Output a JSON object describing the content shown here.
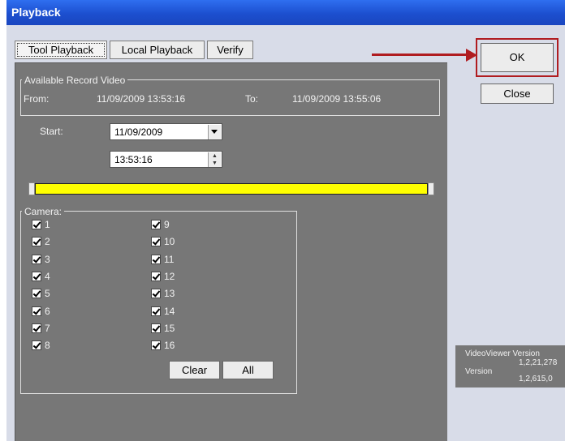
{
  "window": {
    "title": "Playback"
  },
  "tabs": [
    {
      "label": "Tool Playback",
      "active": true
    },
    {
      "label": "Local Playback",
      "active": false
    },
    {
      "label": "Verify",
      "active": false
    }
  ],
  "record": {
    "legend": "Available Record Video",
    "from_label": "From:",
    "from_value": "11/09/2009 13:53:16",
    "to_label": "To:",
    "to_value": "11/09/2009 13:55:06"
  },
  "start": {
    "label": "Start:",
    "date": "11/09/2009",
    "time": "13:53:16"
  },
  "slider": {
    "fill_fraction": 1.0,
    "color": "#ffff00"
  },
  "cameras": {
    "legend": "Camera:",
    "items": [
      {
        "label": "1",
        "checked": true
      },
      {
        "label": "2",
        "checked": true
      },
      {
        "label": "3",
        "checked": true
      },
      {
        "label": "4",
        "checked": true
      },
      {
        "label": "5",
        "checked": true
      },
      {
        "label": "6",
        "checked": true
      },
      {
        "label": "7",
        "checked": true
      },
      {
        "label": "8",
        "checked": true
      },
      {
        "label": "9",
        "checked": true
      },
      {
        "label": "10",
        "checked": true
      },
      {
        "label": "11",
        "checked": true
      },
      {
        "label": "12",
        "checked": true
      },
      {
        "label": "13",
        "checked": true
      },
      {
        "label": "14",
        "checked": true
      },
      {
        "label": "15",
        "checked": true
      },
      {
        "label": "16",
        "checked": true
      }
    ],
    "clear_label": "Clear",
    "all_label": "All"
  },
  "buttons": {
    "ok": "OK",
    "close": "Close"
  },
  "version": {
    "title": "VideoViewer Version",
    "viewer_version": "1,2,21,278",
    "label": "Version",
    "version_value": "1,2,615,0"
  },
  "colors": {
    "title_bar": "#1c4fcf",
    "panel": "#777777",
    "highlight": "#b01c20",
    "slider_fill": "#ffff00"
  }
}
